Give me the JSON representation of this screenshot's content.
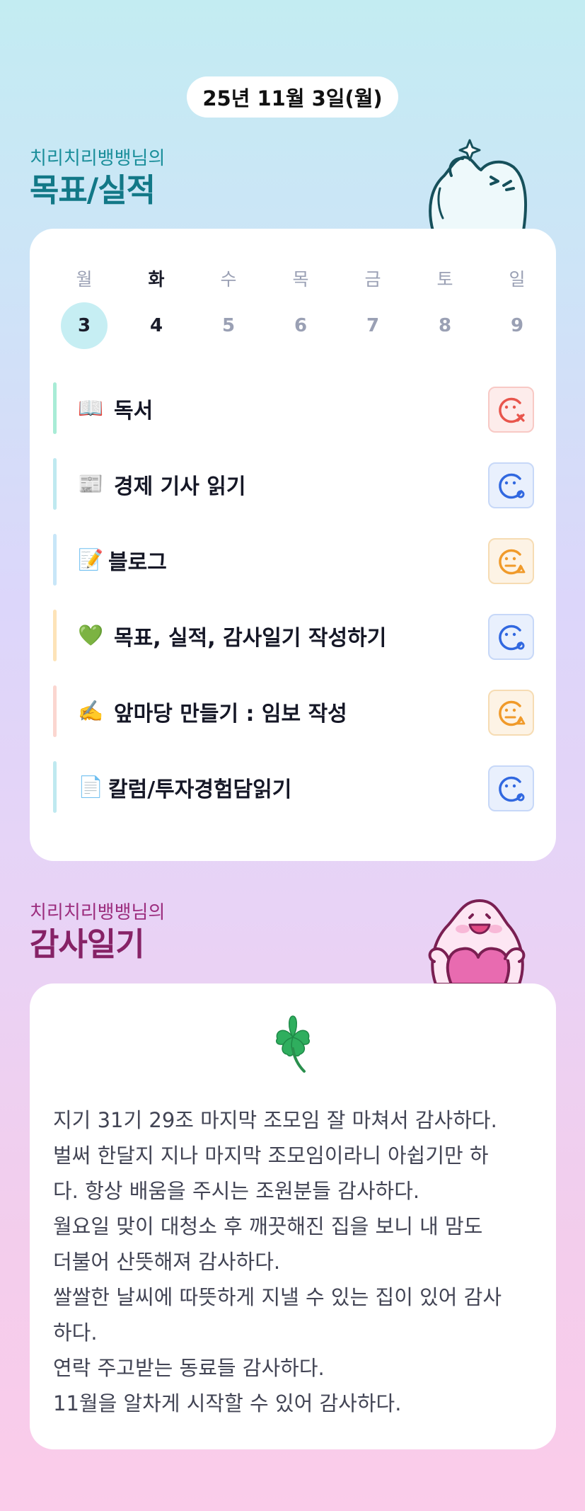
{
  "header": {
    "date": "25년 11월 3일(월)"
  },
  "goals_section": {
    "owner_label": "치리치리뱅뱅님의",
    "title": "목표/실적",
    "weekdays": [
      "월",
      "화",
      "수",
      "목",
      "금",
      "토",
      "일"
    ],
    "days": [
      "3",
      "4",
      "5",
      "6",
      "7",
      "8",
      "9"
    ],
    "selected_index": 0,
    "today_index": 1,
    "items": [
      {
        "emoji": "📖",
        "emoji_icon": "book-icon",
        "label": "독서",
        "bar_color": "#a8ecd6",
        "status": "fail"
      },
      {
        "emoji": "📰",
        "emoji_icon": "newspaper-icon",
        "label": "경제 기사 읽기",
        "bar_color": "#bfe9f0",
        "status": "good"
      },
      {
        "emoji": "📝",
        "emoji_icon": "memo-icon",
        "label": "블로그",
        "bar_color": "#c8e6f8",
        "status": "mid"
      },
      {
        "emoji": "💚",
        "emoji_icon": "green-heart-icon",
        "label": "목표, 실적, 감사일기 작성하기",
        "bar_color": "#fde3b8",
        "status": "good"
      },
      {
        "emoji": "✍️",
        "emoji_icon": "writing-hand-icon",
        "label": "앞마당 만들기 : 임보 작성",
        "bar_color": "#fbd6d0",
        "status": "mid"
      },
      {
        "emoji": "📄",
        "emoji_icon": "page-icon",
        "label": "칼럼/투자경험담읽기",
        "bar_color": "#bfe9f0",
        "status": "good"
      }
    ],
    "status_colors": {
      "fail": "#e8554c",
      "good": "#3168e0",
      "mid": "#f09a2a"
    }
  },
  "gratitude_section": {
    "owner_label": "치리치리뱅뱅님의",
    "title": "감사일기",
    "icon": "four-leaf-clover-icon",
    "lines": [
      "지기 31기 29조 마지막 조모임 잘 마쳐서 감사하다.",
      "벌써 한달지 지나 마지막 조모임이라니 아쉽기만 하",
      "다. 항상 배움을 주시는 조원분들 감사하다.",
      "월요일 맞이 대청소 후 깨끗해진 집을 보니 내 맘도",
      "더불어 산뜻해져 감사하다.",
      "쌀쌀한 날씨에 따뜻하게 지낼 수 있는 집이 있어 감사",
      "하다.",
      "연락 주고받는 동료들 감사하다.",
      "11월을 알차게 시작할 수 있어 감사하다."
    ]
  }
}
